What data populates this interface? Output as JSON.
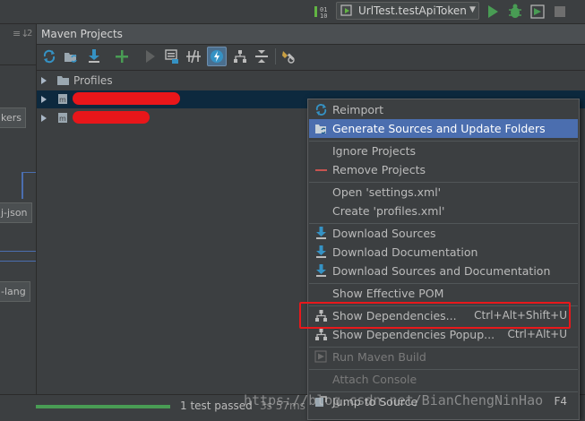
{
  "toolbar": {
    "run_config": "UrlTest.testApiToken",
    "icons": [
      "build-icon",
      "run-config-icon",
      "run-icon",
      "debug-icon",
      "coverage-icon",
      "stop-icon"
    ],
    "accent_run": "#499c54"
  },
  "left_panel": {
    "header_glyph": "≡↓",
    "header_num": "2",
    "chips": [
      "kers",
      "j-json",
      "-lang"
    ]
  },
  "maven": {
    "title": "Maven Projects",
    "toolbar_icons": [
      "reimport-icon",
      "generate-sources-icon",
      "download-icon",
      "add-icon",
      "run-icon",
      "execute-goal-icon",
      "toggle-offline-icon",
      "skip-tests-icon",
      "show-dependencies-icon",
      "collapse-all-icon",
      "settings-icon"
    ],
    "tree": [
      {
        "label": "Profiles",
        "icon": "folder-icon"
      },
      {
        "label": "",
        "icon": "maven-module-icon"
      },
      {
        "label": "",
        "icon": "maven-module-icon"
      }
    ]
  },
  "menu": {
    "items": [
      {
        "label": "Reimport",
        "icon": "reimport-icon",
        "shortcut": ""
      },
      {
        "label": "Generate Sources and Update Folders",
        "icon": "generate-sources-icon",
        "shortcut": "",
        "selected": true
      },
      {
        "label": "Ignore Projects",
        "icon": "",
        "shortcut": ""
      },
      {
        "label": "Remove Projects",
        "icon": "remove-icon",
        "shortcut": ""
      },
      {
        "label": "Open 'settings.xml'",
        "icon": "",
        "shortcut": ""
      },
      {
        "label": "Create 'profiles.xml'",
        "icon": "",
        "shortcut": ""
      },
      {
        "label": "Download Sources",
        "icon": "download-icon",
        "shortcut": ""
      },
      {
        "label": "Download Documentation",
        "icon": "download-icon",
        "shortcut": ""
      },
      {
        "label": "Download Sources and Documentation",
        "icon": "download-icon",
        "shortcut": ""
      },
      {
        "label": "Show Effective POM",
        "icon": "",
        "shortcut": ""
      },
      {
        "label": "Show Dependencies...",
        "icon": "dependencies-icon",
        "shortcut": "Ctrl+Alt+Shift+U"
      },
      {
        "label": "Show Dependencies Popup...",
        "icon": "dependencies-icon",
        "shortcut": "Ctrl+Alt+U"
      },
      {
        "label": "Run Maven Build",
        "icon": "run-icon",
        "shortcut": "",
        "disabled": true
      },
      {
        "label": "Attach Console",
        "icon": "",
        "shortcut": "",
        "disabled": true
      },
      {
        "label": "Jump to Source",
        "icon": "jump-icon",
        "shortcut": "F4"
      }
    ]
  },
  "status": {
    "text": "1 test passed",
    "sub": "3s 57ms"
  },
  "watermark": "https://blog.csdn.net/BianChengNinHao"
}
